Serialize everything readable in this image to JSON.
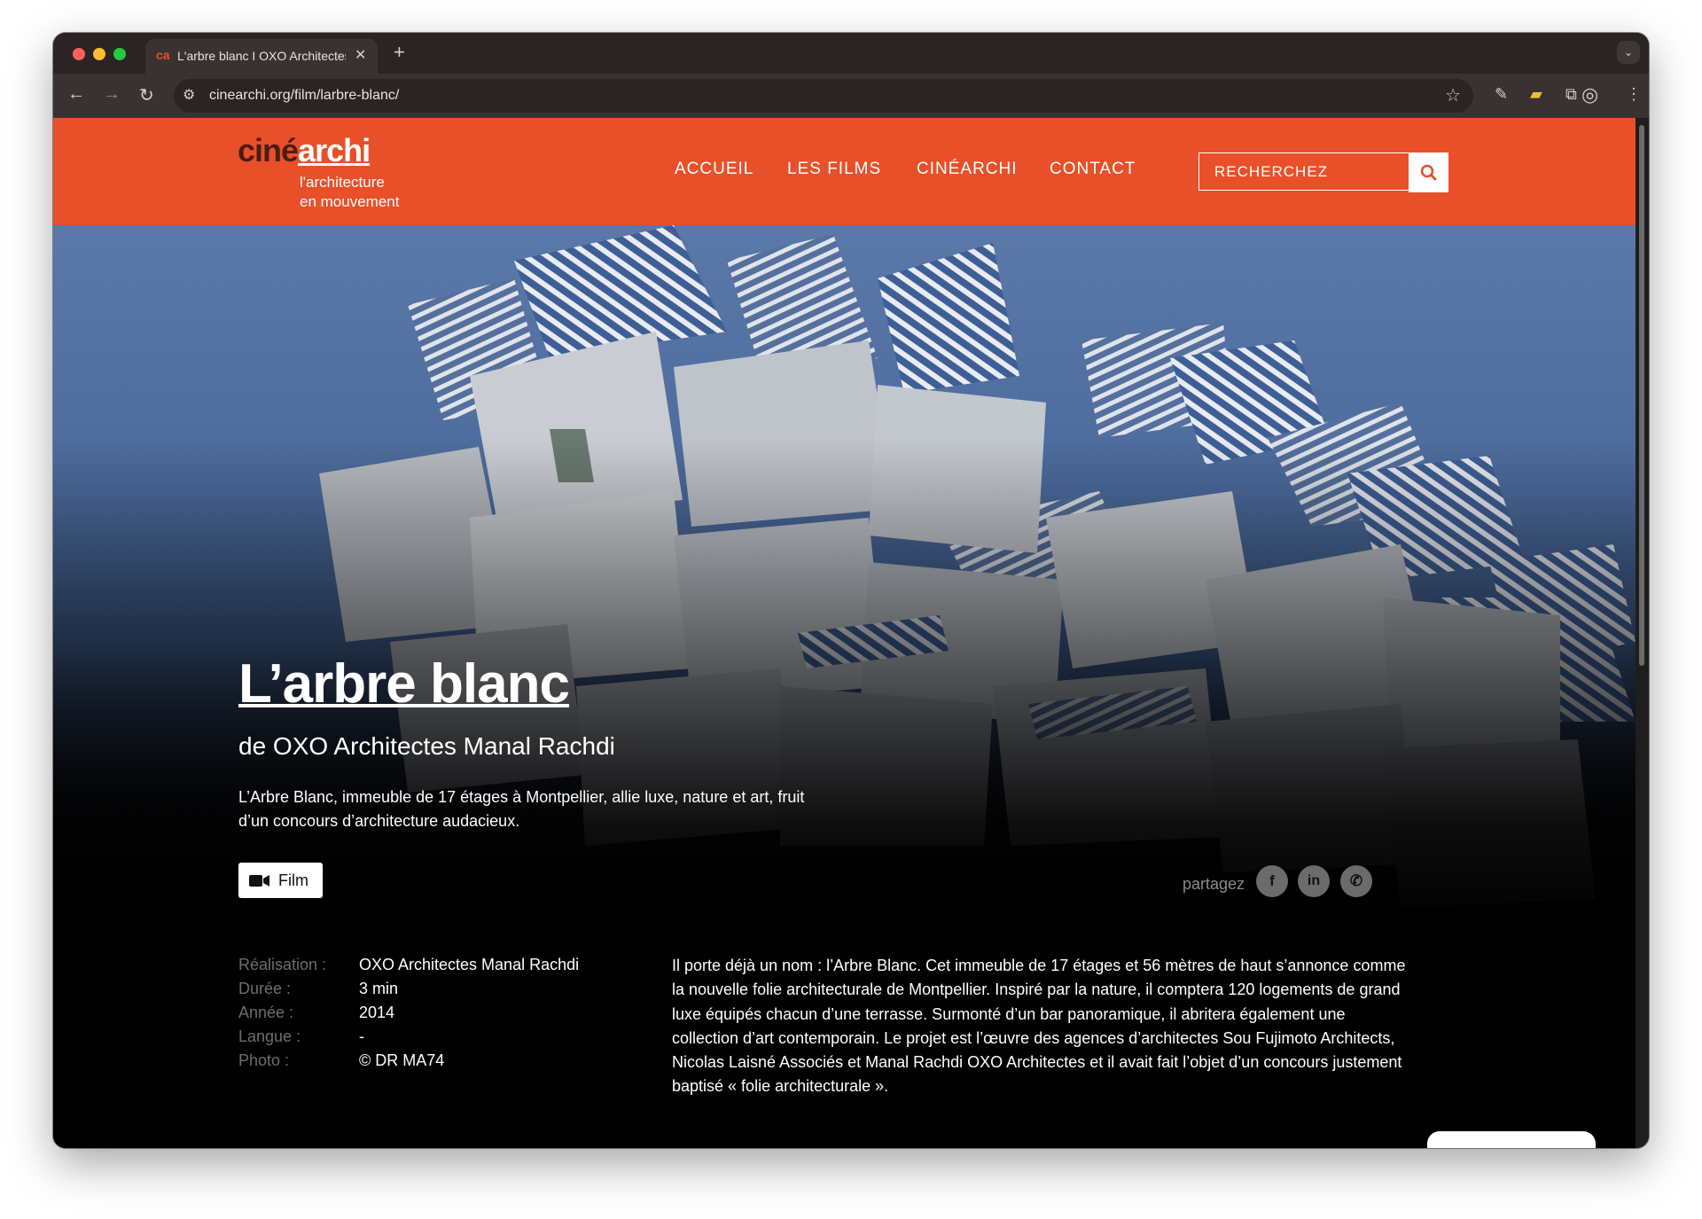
{
  "browser": {
    "tab_title": "L'arbre blanc I OXO Architectes Manal Rachdi",
    "tab_favicon": "ca",
    "url": "cinearchi.org/film/larbre-blanc/"
  },
  "site": {
    "logo": {
      "cine": "ciné",
      "archi": "archi",
      "tagline_1": "l'architecture",
      "tagline_2": "en mouvement"
    },
    "nav": [
      "ACCUEIL",
      "LES FILMS",
      "CINÉARCHI",
      "CONTACT"
    ],
    "search": {
      "placeholder": "RECHERCHEZ"
    },
    "accent_color": "#e8502a"
  },
  "hero": {
    "title": "L’arbre blanc",
    "subtitle": "de OXO Architectes Manal Rachdi",
    "description": "L’Arbre Blanc, immeuble de 17 étages à Montpellier, allie luxe, nature et art, fruit d’un concours d’architecture audacieux.",
    "film_button": "Film",
    "share_label": "partagez",
    "share_icons": [
      "facebook-icon",
      "linkedin-icon",
      "whatsapp-icon"
    ],
    "share_glyphs": {
      "facebook": "f",
      "linkedin": "in",
      "whatsapp": "✆"
    }
  },
  "details": {
    "rows": [
      {
        "label": "Réalisation :",
        "value": "OXO Architectes Manal Rachdi"
      },
      {
        "label": "Durée :",
        "value": "3 min"
      },
      {
        "label": "Année :",
        "value": "2014"
      },
      {
        "label": "Langue :",
        "value": "-"
      },
      {
        "label": "Photo :",
        "value": "© DR MA74"
      }
    ],
    "text": "Il porte déjà un nom : l’Arbre Blanc. Cet immeuble de 17 étages et 56 mètres de haut s’annonce comme la nouvelle folie architecturale de Montpellier. Inspiré par la nature, il comptera 120 logements de grand luxe équipés chacun d’une terrasse. Surmonté d’un bar panoramique, il abritera également une collection d’art contemporain. Le projet est l’œuvre des agences d’architectes Sou Fujimoto Architects, Nicolas Laisné Associés et Manal Rachdi OXO Architectes et il avait fait l’objet d’un concours justement baptisé « folie architecturale »."
  }
}
